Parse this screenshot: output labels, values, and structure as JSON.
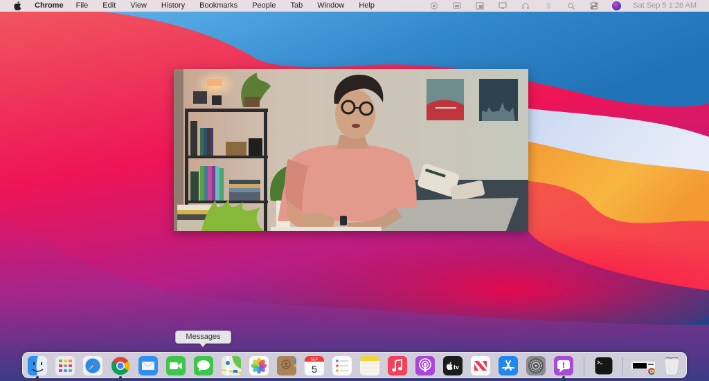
{
  "menubar": {
    "apple_icon": "apple-logo",
    "app_name": "Chrome",
    "items": [
      "File",
      "Edit",
      "View",
      "History",
      "Bookmarks",
      "People",
      "Tab",
      "Window",
      "Help"
    ],
    "status_icons": [
      "record-icon",
      "screen-mirror-icon",
      "window-icon",
      "airplay-icon",
      "headphones-icon",
      "bluetooth-icon",
      "search-icon",
      "control-center-icon",
      "siri-icon"
    ],
    "clock": "Sat Sep 5  1:28 AM"
  },
  "video_window": {
    "content": "person-speaking-video"
  },
  "dock": {
    "tooltip": "Messages",
    "items": [
      {
        "name": "Finder",
        "icon": "finder-icon",
        "running": true
      },
      {
        "name": "Launchpad",
        "icon": "launchpad-icon",
        "running": false
      },
      {
        "name": "Safari",
        "icon": "safari-icon",
        "running": false
      },
      {
        "name": "Chrome",
        "icon": "chrome-icon",
        "running": true
      },
      {
        "name": "Mail",
        "icon": "mail-icon",
        "running": false
      },
      {
        "name": "FaceTime",
        "icon": "facetime-icon",
        "running": false
      },
      {
        "name": "Messages",
        "icon": "messages-icon",
        "running": false
      },
      {
        "name": "Maps",
        "icon": "maps-icon",
        "running": false
      },
      {
        "name": "Photos",
        "icon": "photos-icon",
        "running": false
      },
      {
        "name": "Contacts",
        "icon": "contacts-icon",
        "running": false
      },
      {
        "name": "Calendar",
        "icon": "calendar-icon",
        "running": false,
        "month": "SEP",
        "day": "5"
      },
      {
        "name": "Reminders",
        "icon": "reminders-icon",
        "running": false
      },
      {
        "name": "Notes",
        "icon": "notes-icon",
        "running": false
      },
      {
        "name": "Music",
        "icon": "music-icon",
        "running": false
      },
      {
        "name": "Podcasts",
        "icon": "podcasts-icon",
        "running": false
      },
      {
        "name": "TV",
        "icon": "apple-tv-icon",
        "running": false,
        "label": "tv"
      },
      {
        "name": "News",
        "icon": "news-icon",
        "running": false
      },
      {
        "name": "App Store",
        "icon": "app-store-icon",
        "running": false
      },
      {
        "name": "System Preferences",
        "icon": "system-preferences-icon",
        "running": false
      },
      {
        "name": "Feedback Assistant",
        "icon": "feedback-assistant-icon",
        "running": true
      },
      {
        "name": "Terminal",
        "icon": "terminal-icon",
        "running": false
      },
      {
        "name": "Downloads",
        "icon": "downloads-stack-icon",
        "running": false
      },
      {
        "name": "Trash",
        "icon": "trash-icon",
        "running": false
      }
    ]
  },
  "colors": {
    "menubar_bg": "#e8e8ec",
    "dock_bg": "#e2e2e6",
    "wallpaper_red": "#f2174f",
    "wallpaper_blue": "#2e86c8",
    "wallpaper_orange": "#f6a533",
    "wallpaper_purple": "#3b3b8a"
  }
}
